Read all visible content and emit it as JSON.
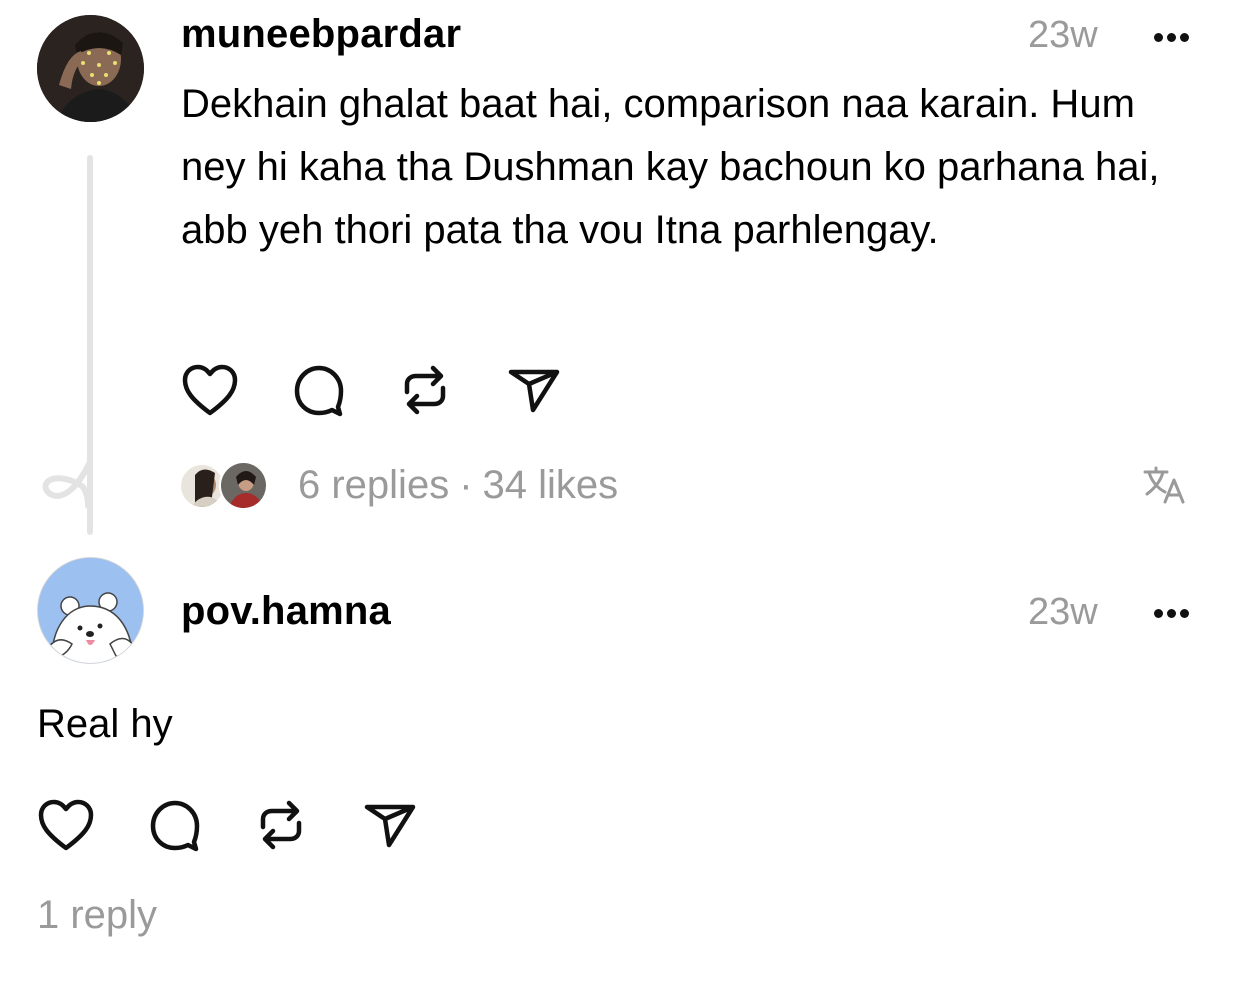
{
  "comments": [
    {
      "username": "muneebpardar",
      "time": "23w",
      "text": "Dekhain ghalat baat hai, comparison naa karain. Hum ney hi kaha tha Dushman kay bachoun ko parhana hai, abb yeh thori pata tha vou Itna parhlengay.",
      "replies": "6 replies",
      "separator": "·",
      "likes": "34 likes"
    },
    {
      "username": "pov.hamna",
      "time": "23w",
      "text": "Real hy",
      "replies": "1 reply"
    }
  ],
  "icons": {
    "like": "heart-icon",
    "reply": "comment-bubble-icon",
    "repost": "repost-icon",
    "share": "send-icon",
    "more": "ellipsis-icon",
    "translate": "translate-icon"
  },
  "colors": {
    "muted": "#9a9a9a",
    "thread_line": "#e3e3e3",
    "avatar2_bg": "#9cc0f0"
  }
}
